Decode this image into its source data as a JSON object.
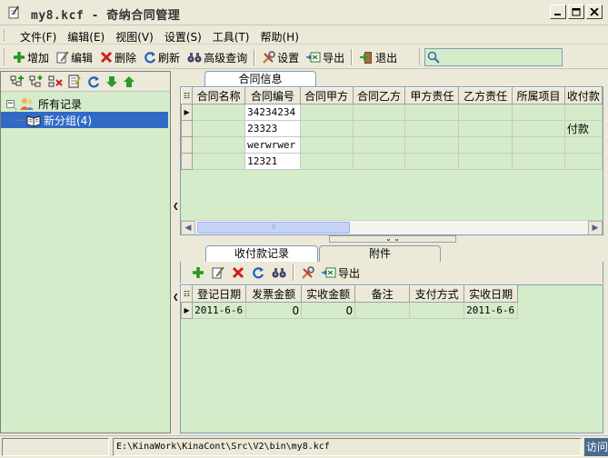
{
  "window": {
    "title": "my8.kcf - 奇纳合同管理",
    "buttons": [
      "minimize-icon",
      "maximize-icon",
      "close-icon"
    ]
  },
  "menu": {
    "items": [
      {
        "label": "文件(F)"
      },
      {
        "label": "编辑(E)"
      },
      {
        "label": "视图(V)"
      },
      {
        "label": "设置(S)"
      },
      {
        "label": "工具(T)"
      },
      {
        "label": "帮助(H)"
      }
    ]
  },
  "toolbar": {
    "add": "增加",
    "edit": "编辑",
    "delete": "删除",
    "refresh": "刷新",
    "advanced_search": "高级查询",
    "settings": "设置",
    "export": "导出",
    "exit": "退出",
    "search_value": ""
  },
  "tree": {
    "root_label": "所有记录",
    "child_label": "新分组(4)"
  },
  "contracts": {
    "tab_label": "合同信息",
    "columns": [
      "合同名称",
      "合同编号",
      "合同甲方",
      "合同乙方",
      "甲方责任",
      "乙方责任",
      "所属项目",
      "收付款"
    ],
    "rows": [
      {
        "name": "",
        "number": "34234234",
        "party_a": "",
        "party_b": "",
        "resp_a": "",
        "resp_b": "",
        "project": "",
        "pay": ""
      },
      {
        "name": "",
        "number": "23323",
        "party_a": "",
        "party_b": "",
        "resp_a": "",
        "resp_b": "",
        "project": "",
        "pay": "付款"
      },
      {
        "name": "",
        "number": "werwrwer",
        "party_a": "",
        "party_b": "",
        "resp_a": "",
        "resp_b": "",
        "project": "",
        "pay": ""
      },
      {
        "name": "",
        "number": "12321",
        "party_a": "",
        "party_b": "",
        "resp_a": "",
        "resp_b": "",
        "project": "",
        "pay": ""
      }
    ]
  },
  "payments": {
    "tab_payments": "收付款记录",
    "tab_attachments": "附件",
    "export_label": "导出",
    "columns": [
      "登记日期",
      "发票金额",
      "实收金额",
      "备注",
      "支付方式",
      "实收日期"
    ],
    "rows": [
      {
        "reg_date": "2011-6-6",
        "invoice": "0",
        "received": "0",
        "note": "",
        "method": "",
        "recv_date": "2011-6-6"
      }
    ]
  },
  "status": {
    "left": "",
    "path": "E:\\KinaWork\\KinaCont\\Src\\V2\\bin\\my8.kcf",
    "right": "访问"
  },
  "colors": {
    "grid_background": "#d4ecc9",
    "selection": "#316ac5",
    "chrome": "#ece9d8"
  }
}
